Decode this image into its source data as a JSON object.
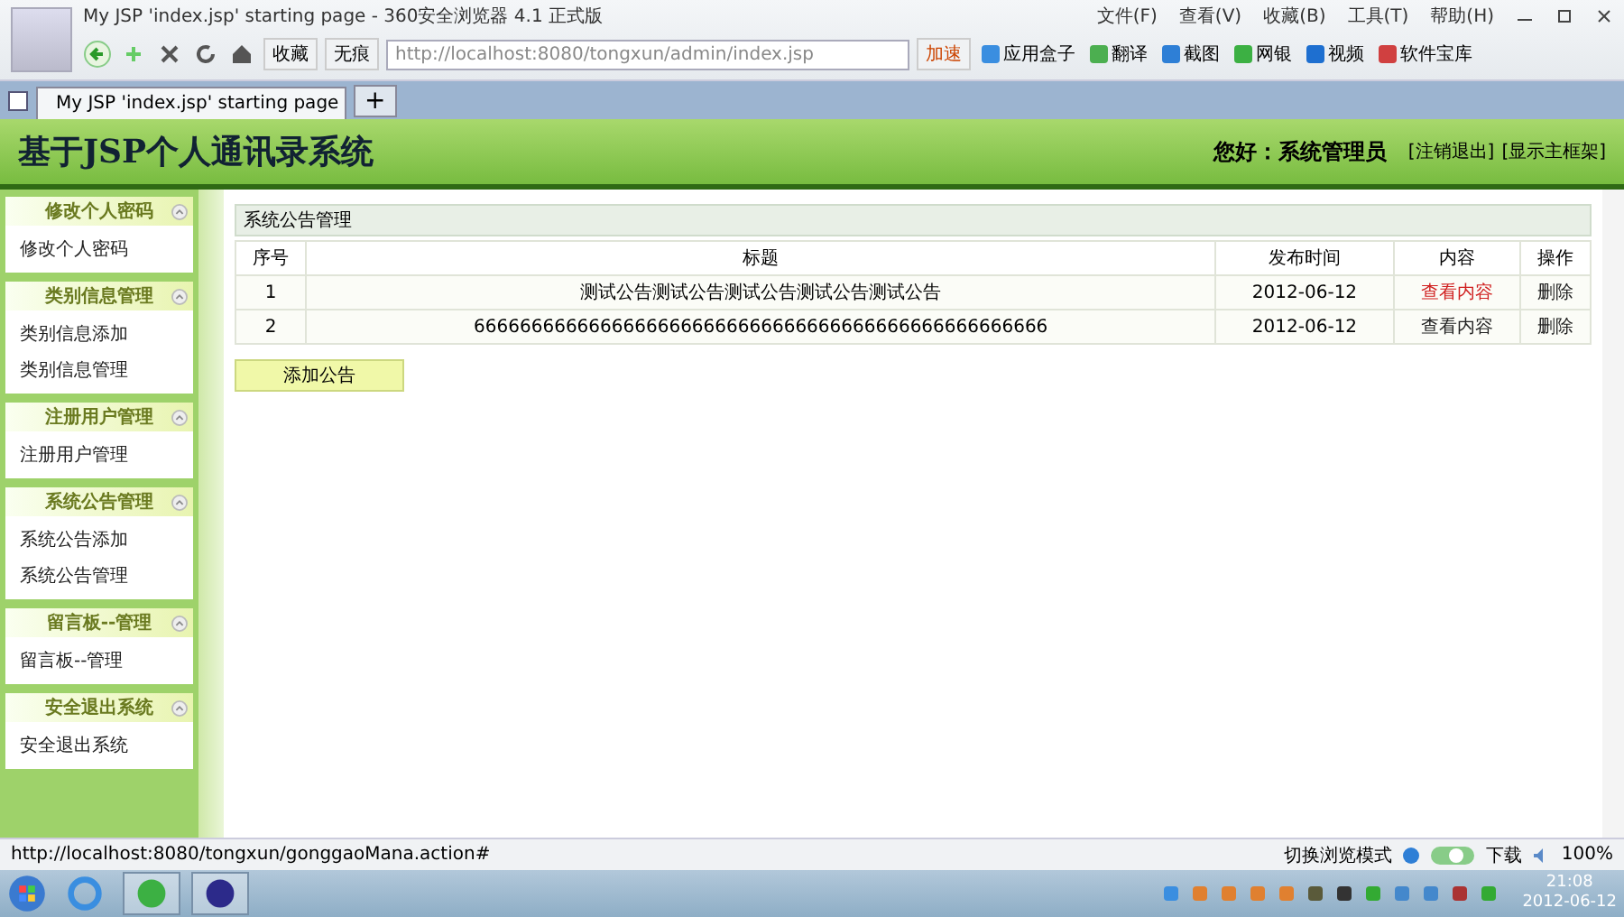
{
  "browser": {
    "title": "My JSP 'index.jsp' starting page - 360安全浏览器 4.1 正式版",
    "menu": [
      "文件(F)",
      "查看(V)",
      "收藏(B)",
      "工具(T)",
      "帮助(H)"
    ],
    "toolbar": {
      "favorites": "收藏",
      "incognito": "无痕",
      "url": "http://localhost:8080/tongxun/admin/index.jsp",
      "speedup": "加速",
      "apps": [
        "应用盒子",
        "翻译",
        "截图",
        "网银",
        "视频",
        "软件宝库"
      ]
    },
    "tabs": [
      {
        "label": "My JSP 'index.jsp' starting page",
        "selected": true
      }
    ],
    "new_tab": "+"
  },
  "page": {
    "title": "基于JSP个人通讯录系统",
    "greeting": "您好：系统管理员",
    "links": [
      "[注销退出]",
      "[显示主框架]"
    ]
  },
  "sidebar": [
    {
      "title": "修改个人密码",
      "items": [
        "修改个人密码"
      ]
    },
    {
      "title": "类别信息管理",
      "items": [
        "类别信息添加",
        "类别信息管理"
      ]
    },
    {
      "title": "注册用户管理",
      "items": [
        "注册用户管理"
      ]
    },
    {
      "title": "系统公告管理",
      "items": [
        "系统公告添加",
        "系统公告管理"
      ]
    },
    {
      "title": "留言板--管理",
      "items": [
        "留言板--管理"
      ]
    },
    {
      "title": "安全退出系统",
      "items": [
        "安全退出系统"
      ]
    }
  ],
  "content": {
    "caption": "系统公告管理",
    "table": {
      "columns": [
        "序号",
        "标题",
        "发布时间",
        "内容",
        "操作"
      ],
      "rows": [
        {
          "no": "1",
          "title": "测试公告测试公告测试公告测试公告测试公告",
          "date": "2012-06-12",
          "view": "查看内容",
          "hovered": true,
          "action": "删除"
        },
        {
          "no": "2",
          "title": "66666666666666666666666666666666666666666666666666",
          "date": "2012-06-12",
          "view": "查看内容",
          "hovered": false,
          "action": "删除"
        }
      ]
    },
    "add_button": "添加公告"
  },
  "status_bar": {
    "url": "http://localhost:8080/tongxun/gonggaoMana.action#",
    "mode": "切换浏览模式",
    "download": "下载",
    "zoom": "100%"
  },
  "taskbar": {
    "time": "21:08",
    "date": "2012-06-12"
  }
}
